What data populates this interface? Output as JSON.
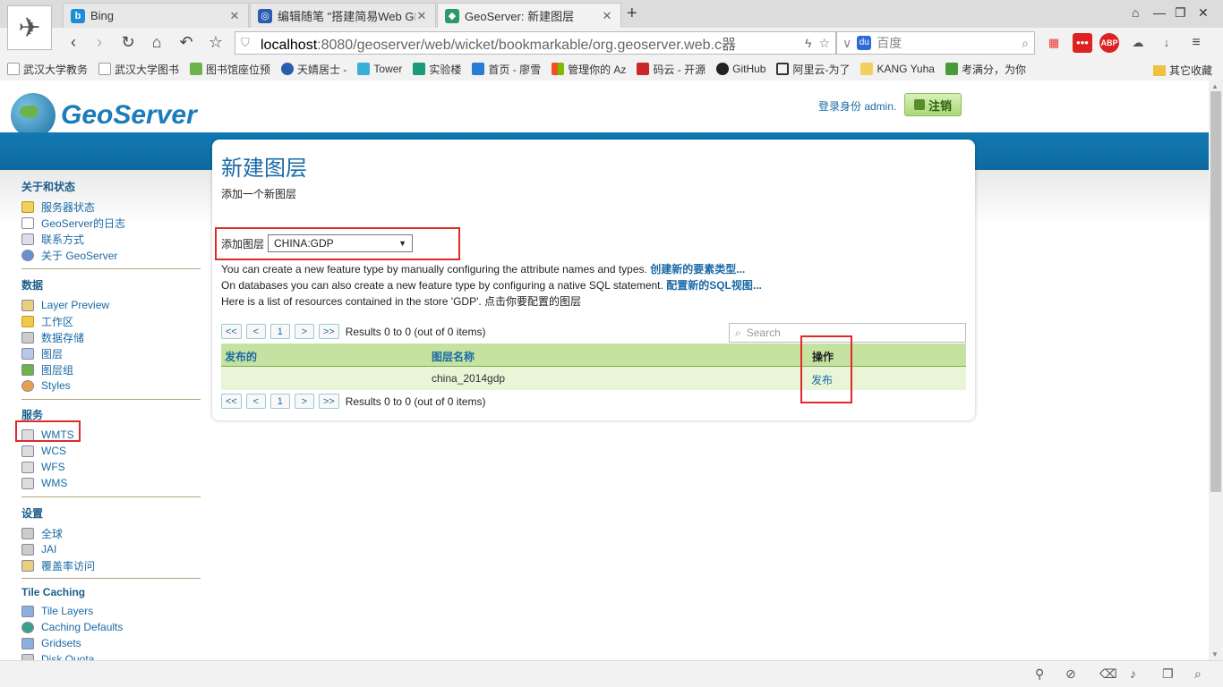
{
  "browser": {
    "tabs": [
      {
        "title": "Bing"
      },
      {
        "title": "编辑随笔 \"搭建简易Web GI"
      },
      {
        "title": "GeoServer: 新建图层"
      }
    ],
    "url_host": "localhost",
    "url_rest": ":8080/geoserver/web/wicket/bookmarkable/org.geoserver.web.c",
    "url_tail": "器",
    "search_placeholder": "百度",
    "bookmarks": [
      "武汉大学教务",
      "武汉大学图书",
      "图书馆座位预",
      "天婧居士 -",
      "Tower",
      "实验楼",
      "首页 - 廖雪",
      "管理你的 Az",
      "码云 - 开源",
      "GitHub",
      "阿里云-为了",
      "KANG Yuha",
      "考满分，为你"
    ],
    "bookmark_other": "其它收藏"
  },
  "header": {
    "logo_text": "GeoServer",
    "login_text": "登录身份 admin.",
    "logout_label": "注销"
  },
  "sidebar": {
    "sections": [
      {
        "title": "关于和状态",
        "items": [
          "服务器状态",
          "GeoServer的日志",
          "联系方式",
          "关于 GeoServer"
        ]
      },
      {
        "title": "数据",
        "items": [
          "Layer Preview",
          "工作区",
          "数据存储",
          "图层",
          "图层组",
          "Styles"
        ]
      },
      {
        "title": "服务",
        "items": [
          "WMTS",
          "WCS",
          "WFS",
          "WMS"
        ]
      },
      {
        "title": "设置",
        "items": [
          "全球",
          "JAI",
          "覆盖率访问"
        ]
      },
      {
        "title": "Tile Caching",
        "items": [
          "Tile Layers",
          "Caching Defaults",
          "Gridsets",
          "Disk Quota"
        ]
      }
    ]
  },
  "main": {
    "title": "新建图层",
    "description": "添加一个新图层",
    "add_layer_label": "添加图层",
    "add_layer_value": "CHINA:GDP",
    "info1_text": "You can create a new feature type by manually configuring the attribute names and types. ",
    "info1_link": "创建新的要素类型...",
    "info2_text": "On databases you can also create a new feature type by configuring a native SQL statement. ",
    "info2_link": "配置新的SQL视图...",
    "info3_text": "Here is a list of resources contained in the store 'GDP'. 点击你要配置的图层",
    "pager": {
      "first": "<<",
      "prev": "<",
      "page": "1",
      "next": ">",
      "last": ">>",
      "results": "Results 0 to 0 (out of 0 items)"
    },
    "search_placeholder": "Search",
    "table": {
      "headers": [
        "发布的",
        "图层名称",
        "操作"
      ],
      "rows": [
        {
          "published": "",
          "name": "china_2014gdp",
          "action": "发布"
        }
      ]
    }
  }
}
